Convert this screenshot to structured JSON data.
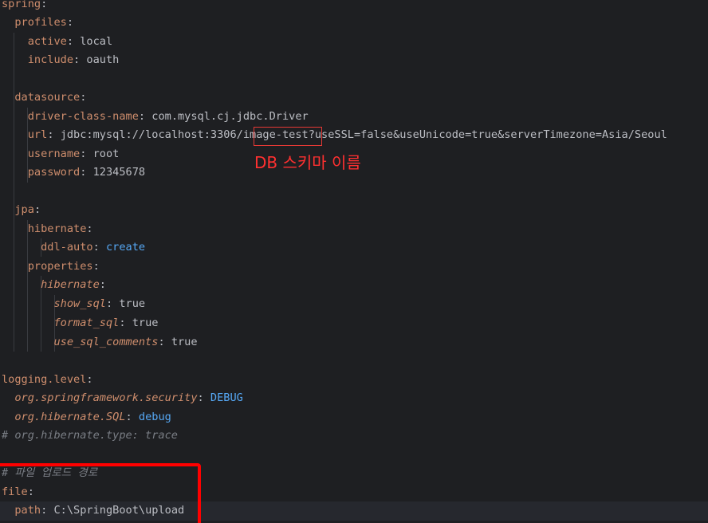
{
  "yaml": {
    "spring_key": "spring",
    "profiles_key": "profiles",
    "active_key": "active",
    "active_value": "local",
    "include_key": "include",
    "include_value": "oauth",
    "datasource_key": "datasource",
    "driver_key": "driver-class-name",
    "driver_value": "com.mysql.cj.jdbc.Driver",
    "url_key": "url",
    "url_prefix": "jdbc:mysql://localhost:3306/",
    "url_schema": "image-test",
    "url_suffix": "?useSSL=false&useUnicode=true&serverTimezone=Asia/Seoul",
    "username_key": "username",
    "username_value": "root",
    "password_key": "password",
    "password_value": "12345678",
    "jpa_key": "jpa",
    "hibernate_key": "hibernate",
    "ddl_auto_key": "ddl-auto",
    "ddl_auto_value": "create",
    "properties_key": "properties",
    "hibernate_inner_key": "hibernate",
    "show_sql_key": "show_sql",
    "show_sql_value": "true",
    "format_sql_key": "format_sql",
    "format_sql_value": "true",
    "use_sql_comments_key": "use_sql_comments",
    "use_sql_comments_value": "true",
    "logging_key": "logging.level",
    "security_key": "org.springframework.security",
    "security_value": "DEBUG",
    "hibernate_sql_key": "org.hibernate.SQL",
    "hibernate_sql_value": "debug",
    "hibernate_type_comment": "# org.hibernate.type: trace",
    "upload_comment": "# 파일 업로드 경로",
    "file_key": "file",
    "path_key": "path",
    "path_value": "C:\\SpringBoot\\upload"
  },
  "annotation": {
    "schema_label": "DB 스키마 이름"
  },
  "colors": {
    "background": "#1e1f22",
    "key": "#cf8e6d",
    "text": "#bcbec4",
    "keyword": "#56a8f5",
    "number": "#2aacb8",
    "comment": "#7a7e85",
    "annotation": "#ff3030"
  }
}
